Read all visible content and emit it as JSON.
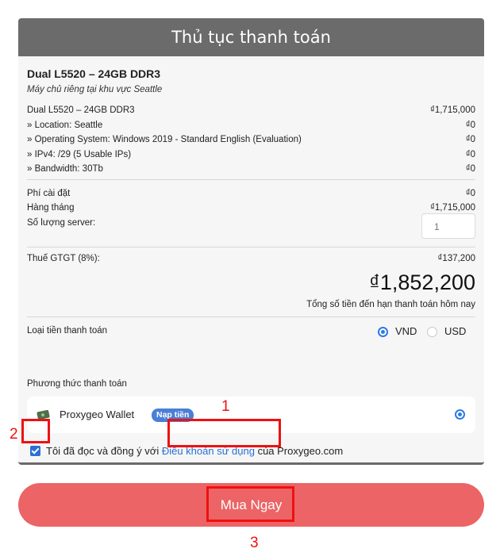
{
  "header": {
    "title": "Thủ tục thanh toán"
  },
  "product": {
    "title": "Dual L5520 – 24GB DDR3",
    "subtitle": "Máy chủ riêng tại khu vực Seattle"
  },
  "line_items": [
    {
      "label": "Dual L5520 – 24GB DDR3",
      "price": "₫1,715,000"
    },
    {
      "label": "» Location: Seattle",
      "price": "₫0"
    },
    {
      "label": "» Operating System: Windows 2019 - Standard English (Evaluation)",
      "price": "₫0"
    },
    {
      "label": "» IPv4: /29 (5 Usable IPs)",
      "price": "₫0"
    },
    {
      "label": "» Bandwidth: 30Tb",
      "price": "₫0"
    }
  ],
  "fees": [
    {
      "label": "Phí cài đặt",
      "price": "₫0"
    },
    {
      "label": "Hàng tháng",
      "price": "₫1,715,000"
    }
  ],
  "quantity": {
    "label": "Số lượng server:",
    "value": "1"
  },
  "tax": {
    "label": "Thuế GTGT (8%):",
    "price": "₫137,200"
  },
  "total": {
    "amount": "₫1,852,200",
    "caption": "Tổng số tiền đến hạn thanh toán hôm nay"
  },
  "currency": {
    "label": "Loại tiền thanh toán",
    "options": [
      "VND",
      "USD"
    ],
    "selected": "VND"
  },
  "payment": {
    "label": "Phương thức thanh toán",
    "method": "Proxygeo Wallet",
    "badge": "Nạp tiền",
    "icon": "wallet-icon"
  },
  "agreement": {
    "prefix": "Tôi đã đọc và đồng ý với ",
    "link": "Điều khoản sử dụng",
    "suffix": " của Proxygeo.com",
    "checked": true
  },
  "buy_button": {
    "label": "Mua Ngay"
  },
  "annotations": [
    "1",
    "2",
    "3"
  ],
  "colors": {
    "header": "#6b6b6b",
    "accent": "#2b6fd6",
    "buy_button": "#ec6465",
    "annotation": "#ee1111"
  }
}
